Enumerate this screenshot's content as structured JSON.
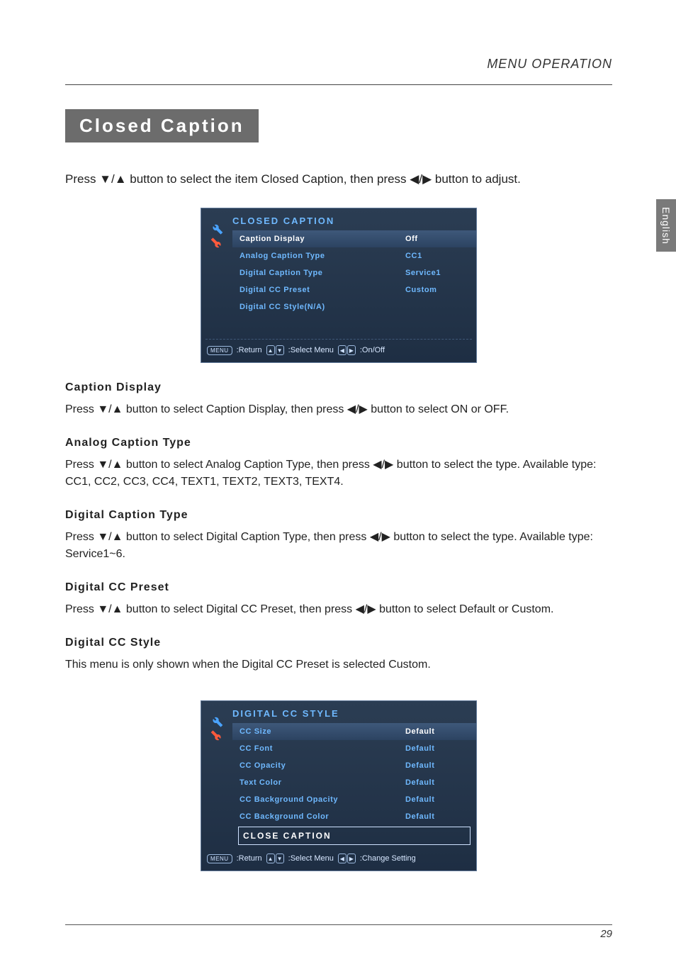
{
  "header": {
    "title": "MENU OPERATION"
  },
  "side_tab": "English",
  "page_title": "Closed Caption",
  "intro": "Press ▼/▲ button to select the item Closed Caption, then press ◀/▶ button to adjust.",
  "osd1": {
    "title": "CLOSED CAPTION",
    "rows": [
      {
        "label": "Caption Display",
        "value": "Off",
        "selected": true
      },
      {
        "label": "Analog Caption Type",
        "value": "CC1"
      },
      {
        "label": "Digital Caption Type",
        "value": "Service1"
      },
      {
        "label": "Digital CC Preset",
        "value": "Custom"
      },
      {
        "label": "Digital CC Style(N/A)",
        "value": ""
      }
    ],
    "footer": {
      "menu": "MENU",
      "return": ":Return",
      "select": ":Select Menu",
      "onoff": ":On/Off"
    }
  },
  "sections": [
    {
      "head": "Caption Display",
      "body": "Press ▼/▲ button to select Caption Display, then press ◀/▶ button to select ON or OFF."
    },
    {
      "head": "Analog Caption Type",
      "body": "Press ▼/▲ button to select Analog Caption Type, then press ◀/▶ button to select the type. Available type: CC1, CC2, CC3, CC4, TEXT1, TEXT2, TEXT3, TEXT4."
    },
    {
      "head": "Digital Caption Type",
      "body": "Press ▼/▲ button to select Digital Caption Type, then press ◀/▶ button to select the type. Available type: Service1~6."
    },
    {
      "head": "Digital CC Preset",
      "body": "Press ▼/▲ button to select Digital CC Preset, then press ◀/▶ button to select Default or Custom."
    },
    {
      "head": "Digital CC Style",
      "body": "This menu is only shown when the Digital CC Preset is selected Custom."
    }
  ],
  "osd2": {
    "title": "DIGITAL CC STYLE",
    "rows": [
      {
        "label": "CC Size",
        "value": "Default",
        "selected": true
      },
      {
        "label": "CC Font",
        "value": "Default"
      },
      {
        "label": "CC Opacity",
        "value": "Default"
      },
      {
        "label": "Text Color",
        "value": "Default"
      },
      {
        "label": "CC Background Opacity",
        "value": "Default"
      },
      {
        "label": "CC Background Color",
        "value": "Default"
      }
    ],
    "close_row": "CLOSE CAPTION",
    "footer": {
      "menu": "MENU",
      "return": ":Return",
      "select": ":Select Menu",
      "change": ":Change Setting"
    }
  },
  "page_number": "29"
}
